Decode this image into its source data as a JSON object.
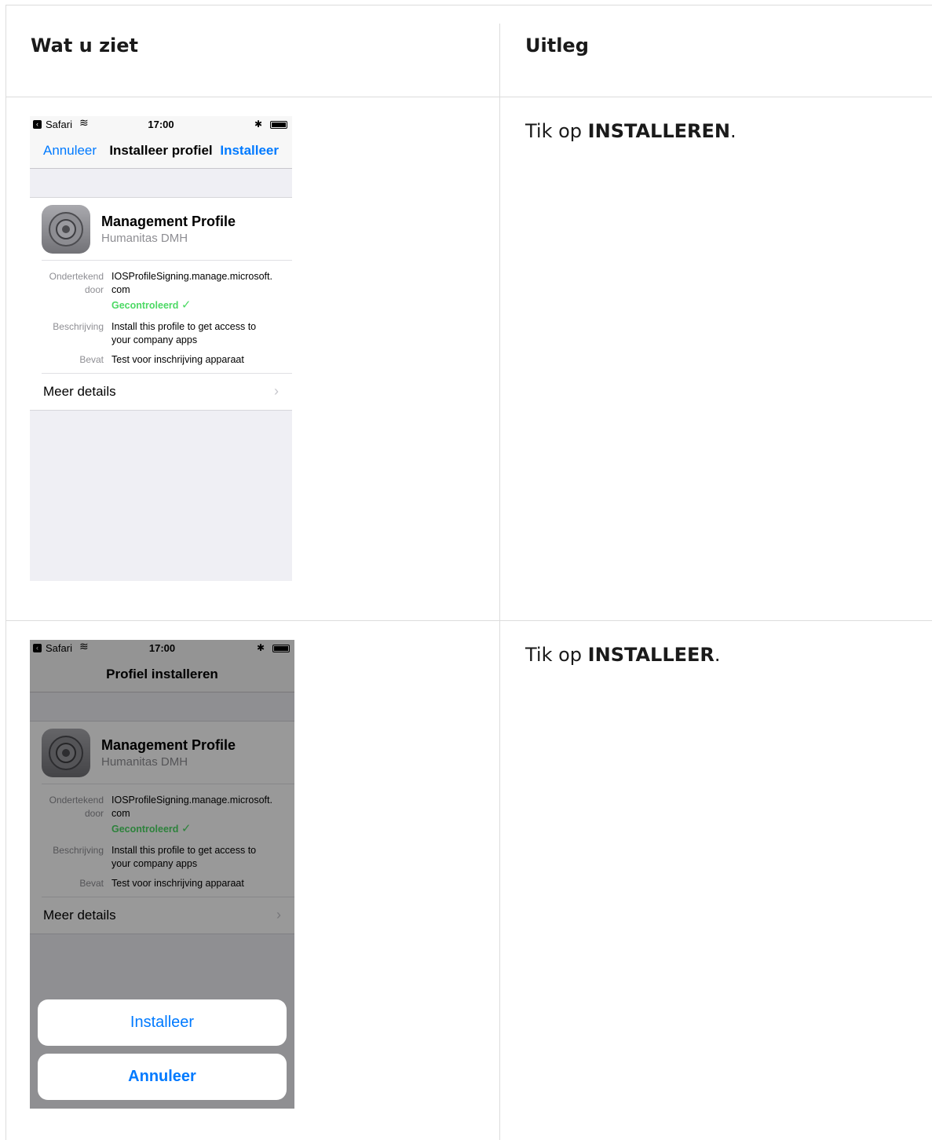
{
  "table": {
    "header_left": "Wat u ziet",
    "header_right": "Uitleg"
  },
  "rows": [
    {
      "explanation_prefix": "Tik op ",
      "explanation_bold": "INSTALLEREN",
      "explanation_suffix": ".",
      "phone": {
        "status": {
          "app": "Safari",
          "time": "17:00"
        },
        "navbar": {
          "left": "Annuleer",
          "title": "Installeer profiel",
          "right": "Installeer"
        },
        "profile": {
          "title": "Management Profile",
          "subtitle": "Humanitas DMH"
        },
        "details": {
          "signed_label_1": "Ondertekend",
          "signed_label_2": "door",
          "signed_value_1": "IOSProfileSigning.manage.microsoft.",
          "signed_value_2": "com",
          "verified": "Gecontroleerd",
          "description_label": "Beschrijving",
          "description_value_1": "Install this profile to get access to",
          "description_value_2": "your company apps",
          "contains_label": "Bevat",
          "contains_value": "Test voor inschrijving apparaat"
        },
        "more_details": "Meer details"
      }
    },
    {
      "explanation_prefix": "Tik op ",
      "explanation_bold": "INSTALLEER",
      "explanation_suffix": ".",
      "phone": {
        "status": {
          "app": "Safari",
          "time": "17:00"
        },
        "navbar": {
          "title": "Profiel installeren"
        },
        "profile": {
          "title": "Management Profile",
          "subtitle": "Humanitas DMH"
        },
        "details": {
          "signed_label_1": "Ondertekend",
          "signed_label_2": "door",
          "signed_value_1": "IOSProfileSigning.manage.microsoft.",
          "signed_value_2": "com",
          "verified": "Gecontroleerd",
          "description_label": "Beschrijving",
          "description_value_1": "Install this profile to get access to",
          "description_value_2": "your company apps",
          "contains_label": "Bevat",
          "contains_value": "Test voor inschrijving apparaat"
        },
        "more_details": "Meer details",
        "sheet": {
          "install": "Installeer",
          "cancel": "Annuleer"
        }
      }
    }
  ],
  "colors": {
    "ios_blue": "#007aff",
    "ios_green": "#4cd964",
    "grid_line": "#dcdcdc"
  }
}
